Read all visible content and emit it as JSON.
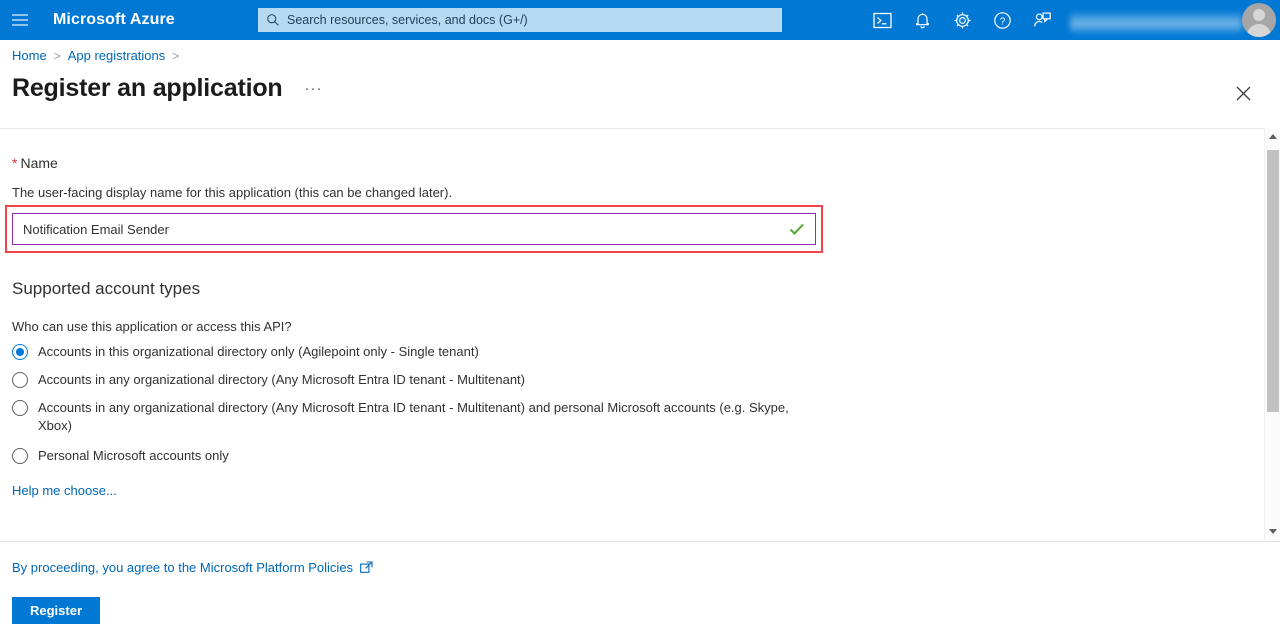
{
  "topbar": {
    "menu_icon": "hamburger-icon",
    "brand": "Microsoft Azure",
    "search": {
      "icon": "search-icon",
      "placeholder": "Search resources, services, and docs (G+/)",
      "value": ""
    },
    "icons": [
      {
        "name": "cloud-shell-icon",
        "title": "Cloud Shell"
      },
      {
        "name": "notifications-bell-icon",
        "title": "Notifications"
      },
      {
        "name": "settings-gear-icon",
        "title": "Settings"
      },
      {
        "name": "help-question-icon",
        "title": "Help"
      },
      {
        "name": "feedback-person-icon",
        "title": "Feedback"
      }
    ],
    "account_label": "",
    "avatar": "user-avatar",
    "background_color": "#0078d4"
  },
  "breadcrumb": {
    "items": [
      {
        "label": "Home",
        "link": true
      },
      {
        "label": "App registrations",
        "link": true
      }
    ],
    "separator": ">"
  },
  "header": {
    "title": "Register an application",
    "more_label": "···",
    "close_icon": "close-icon"
  },
  "form": {
    "name_field": {
      "required_marker": "*",
      "label": "Name",
      "helper_text": "The user-facing display name for this application (this can be changed later).",
      "value": "Notification Email Sender",
      "placeholder": "",
      "valid_icon": "green-checkmark-icon",
      "border_color": "#8b2fb3",
      "highlight_color": "#f1444c"
    },
    "account_types": {
      "section_title": "Supported account types",
      "question": "Who can use this application or access this API?",
      "options": [
        {
          "label": "Accounts in this organizational directory only (Agilepoint only - Single tenant)",
          "selected": true
        },
        {
          "label": "Accounts in any organizational directory (Any Microsoft Entra ID tenant - Multitenant)",
          "selected": false
        },
        {
          "label": "Accounts in any organizational directory (Any Microsoft Entra ID tenant - Multitenant) and personal Microsoft accounts (e.g. Skype, Xbox)",
          "selected": false
        },
        {
          "label": "Personal Microsoft accounts only",
          "selected": false
        }
      ],
      "help_link": "Help me choose..."
    }
  },
  "footer": {
    "policy_text": "By proceeding, you agree to the Microsoft Platform Policies",
    "policy_icon": "external-link-icon",
    "register_label": "Register",
    "accent_color": "#0078d4"
  },
  "scrollbar": {
    "up_icon": "chevron-up-icon",
    "down_icon": "chevron-down-icon",
    "thumb": "scroll-thumb"
  }
}
